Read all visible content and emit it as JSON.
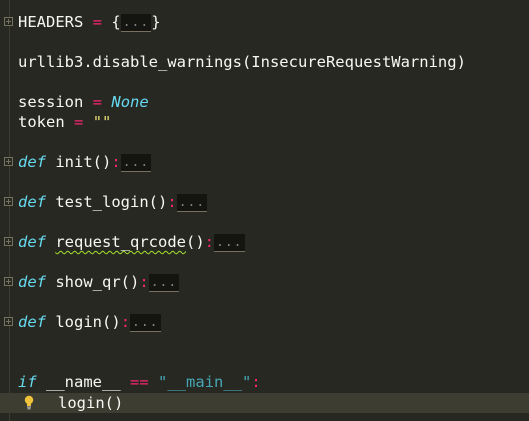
{
  "code": {
    "headers": {
      "name": "HEADERS",
      "op": "=",
      "open": "{",
      "folded": "...",
      "close": "}"
    },
    "urllib": "urllib3.disable_warnings(InsecureRequestWarning)",
    "session": {
      "name": "session",
      "op": "=",
      "value": "None"
    },
    "token": {
      "name": "token",
      "op": "=",
      "value": "\"\""
    },
    "funcs": [
      {
        "kw": "def",
        "name": "init",
        "parens": "()",
        "colon": ":",
        "folded": "..."
      },
      {
        "kw": "def",
        "name": "test_login",
        "parens": "()",
        "colon": ":",
        "folded": "..."
      },
      {
        "kw": "def",
        "name": "request_qrcode",
        "parens": "()",
        "colon": ":",
        "folded": "..."
      },
      {
        "kw": "def",
        "name": "show_qr",
        "parens": "()",
        "colon": ":",
        "folded": "..."
      },
      {
        "kw": "def",
        "name": "login",
        "parens": "()",
        "colon": ":",
        "folded": "..."
      }
    ],
    "main_if": {
      "kw": "if",
      "name": "__name__",
      "op": "==",
      "str_open": "\"",
      "str_value": "__main__",
      "str_close": "\"",
      "colon": ":"
    },
    "main_call": "login()"
  },
  "colors": {
    "background": "#272822",
    "keyword": "#66d9ef",
    "operator": "#f92672",
    "string": "#e6db74",
    "text": "#f8f8f2"
  },
  "icons": {
    "fold": "fold-plus-icon",
    "bulb": "lightbulb-icon"
  }
}
